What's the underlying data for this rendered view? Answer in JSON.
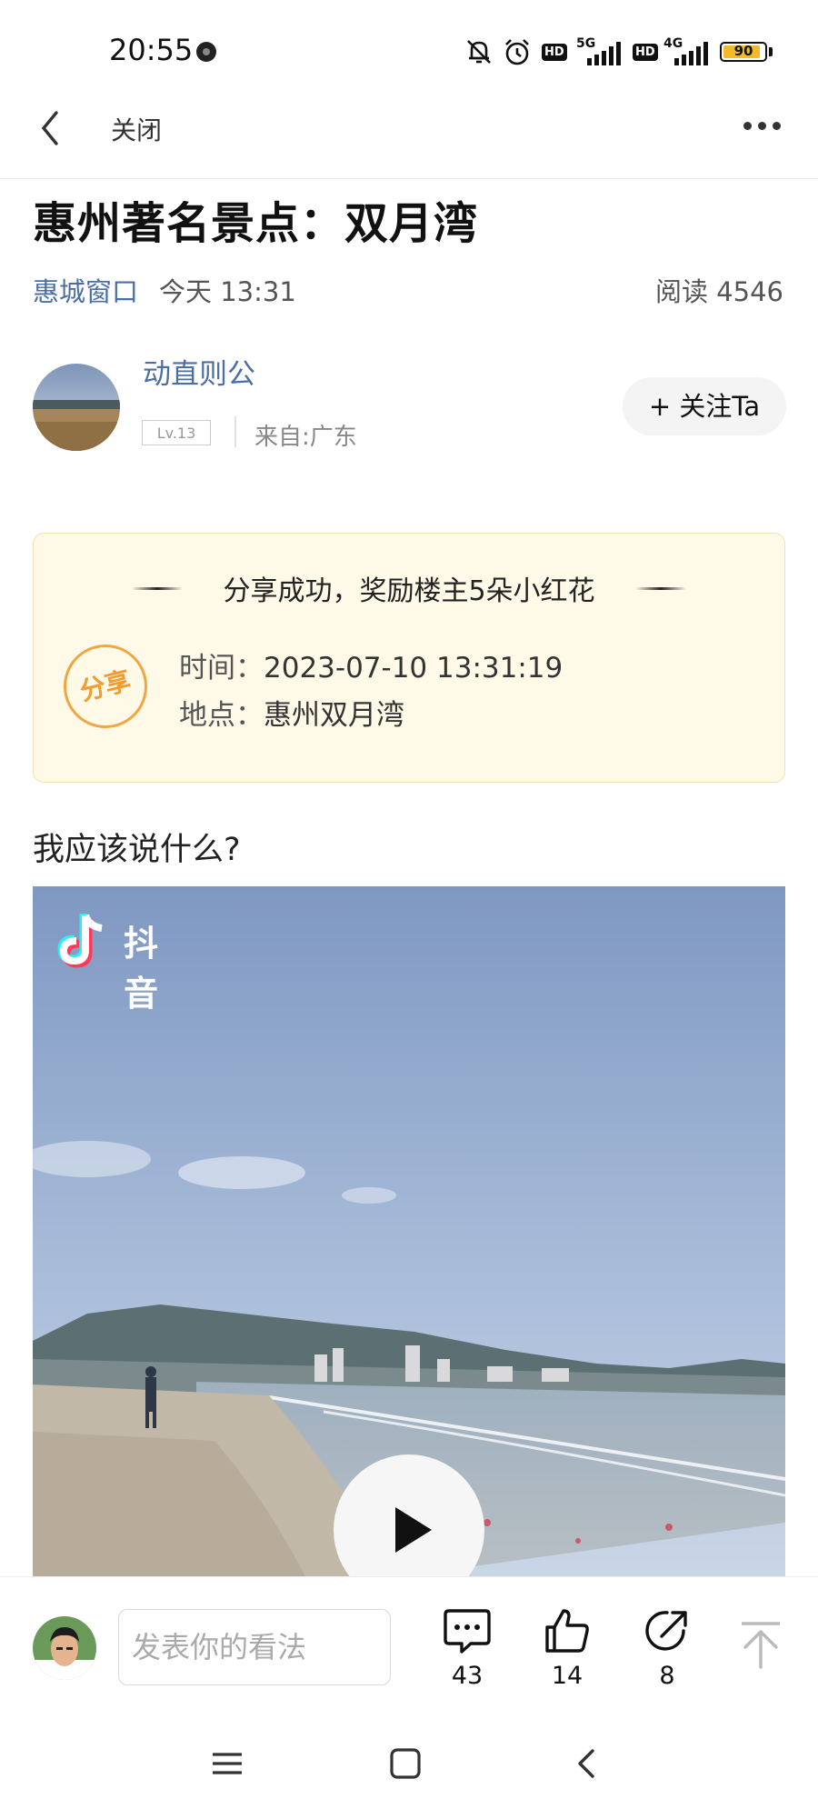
{
  "status_bar": {
    "time": "20:55",
    "net1": "5G",
    "net2": "4G",
    "hd": "HD",
    "battery": "90",
    "battery_fraction": 0.9
  },
  "nav": {
    "back_icon": "chevron-left-icon",
    "close_label": "关闭",
    "more_icon": "more-dots-icon"
  },
  "article": {
    "title": "惠州著名景点：双月湾",
    "channel": "惠城窗口",
    "time": "今天 13:31",
    "reads": "阅读 4546"
  },
  "author": {
    "name": "动直则公",
    "level": "Lv.13",
    "from": "来自:广东",
    "follow_label": "+ 关注Ta"
  },
  "share_card": {
    "headline": "分享成功，奖励楼主5朵小红花",
    "stamp": "分享",
    "time_label": "时间：",
    "time_value": "2023-07-10 13:31:19",
    "place_label": "地点：",
    "place_value": "惠州双月湾"
  },
  "post": {
    "text": "我应该说什么?",
    "video_brand": "抖音"
  },
  "bottom_bar": {
    "comment_placeholder": "发表你的看法",
    "comments": "43",
    "likes": "14",
    "shares": "8"
  },
  "colors": {
    "link_blue": "#4a6fa5",
    "card_bg": "#fff9e8",
    "stamp_orange": "#f29b2e"
  }
}
